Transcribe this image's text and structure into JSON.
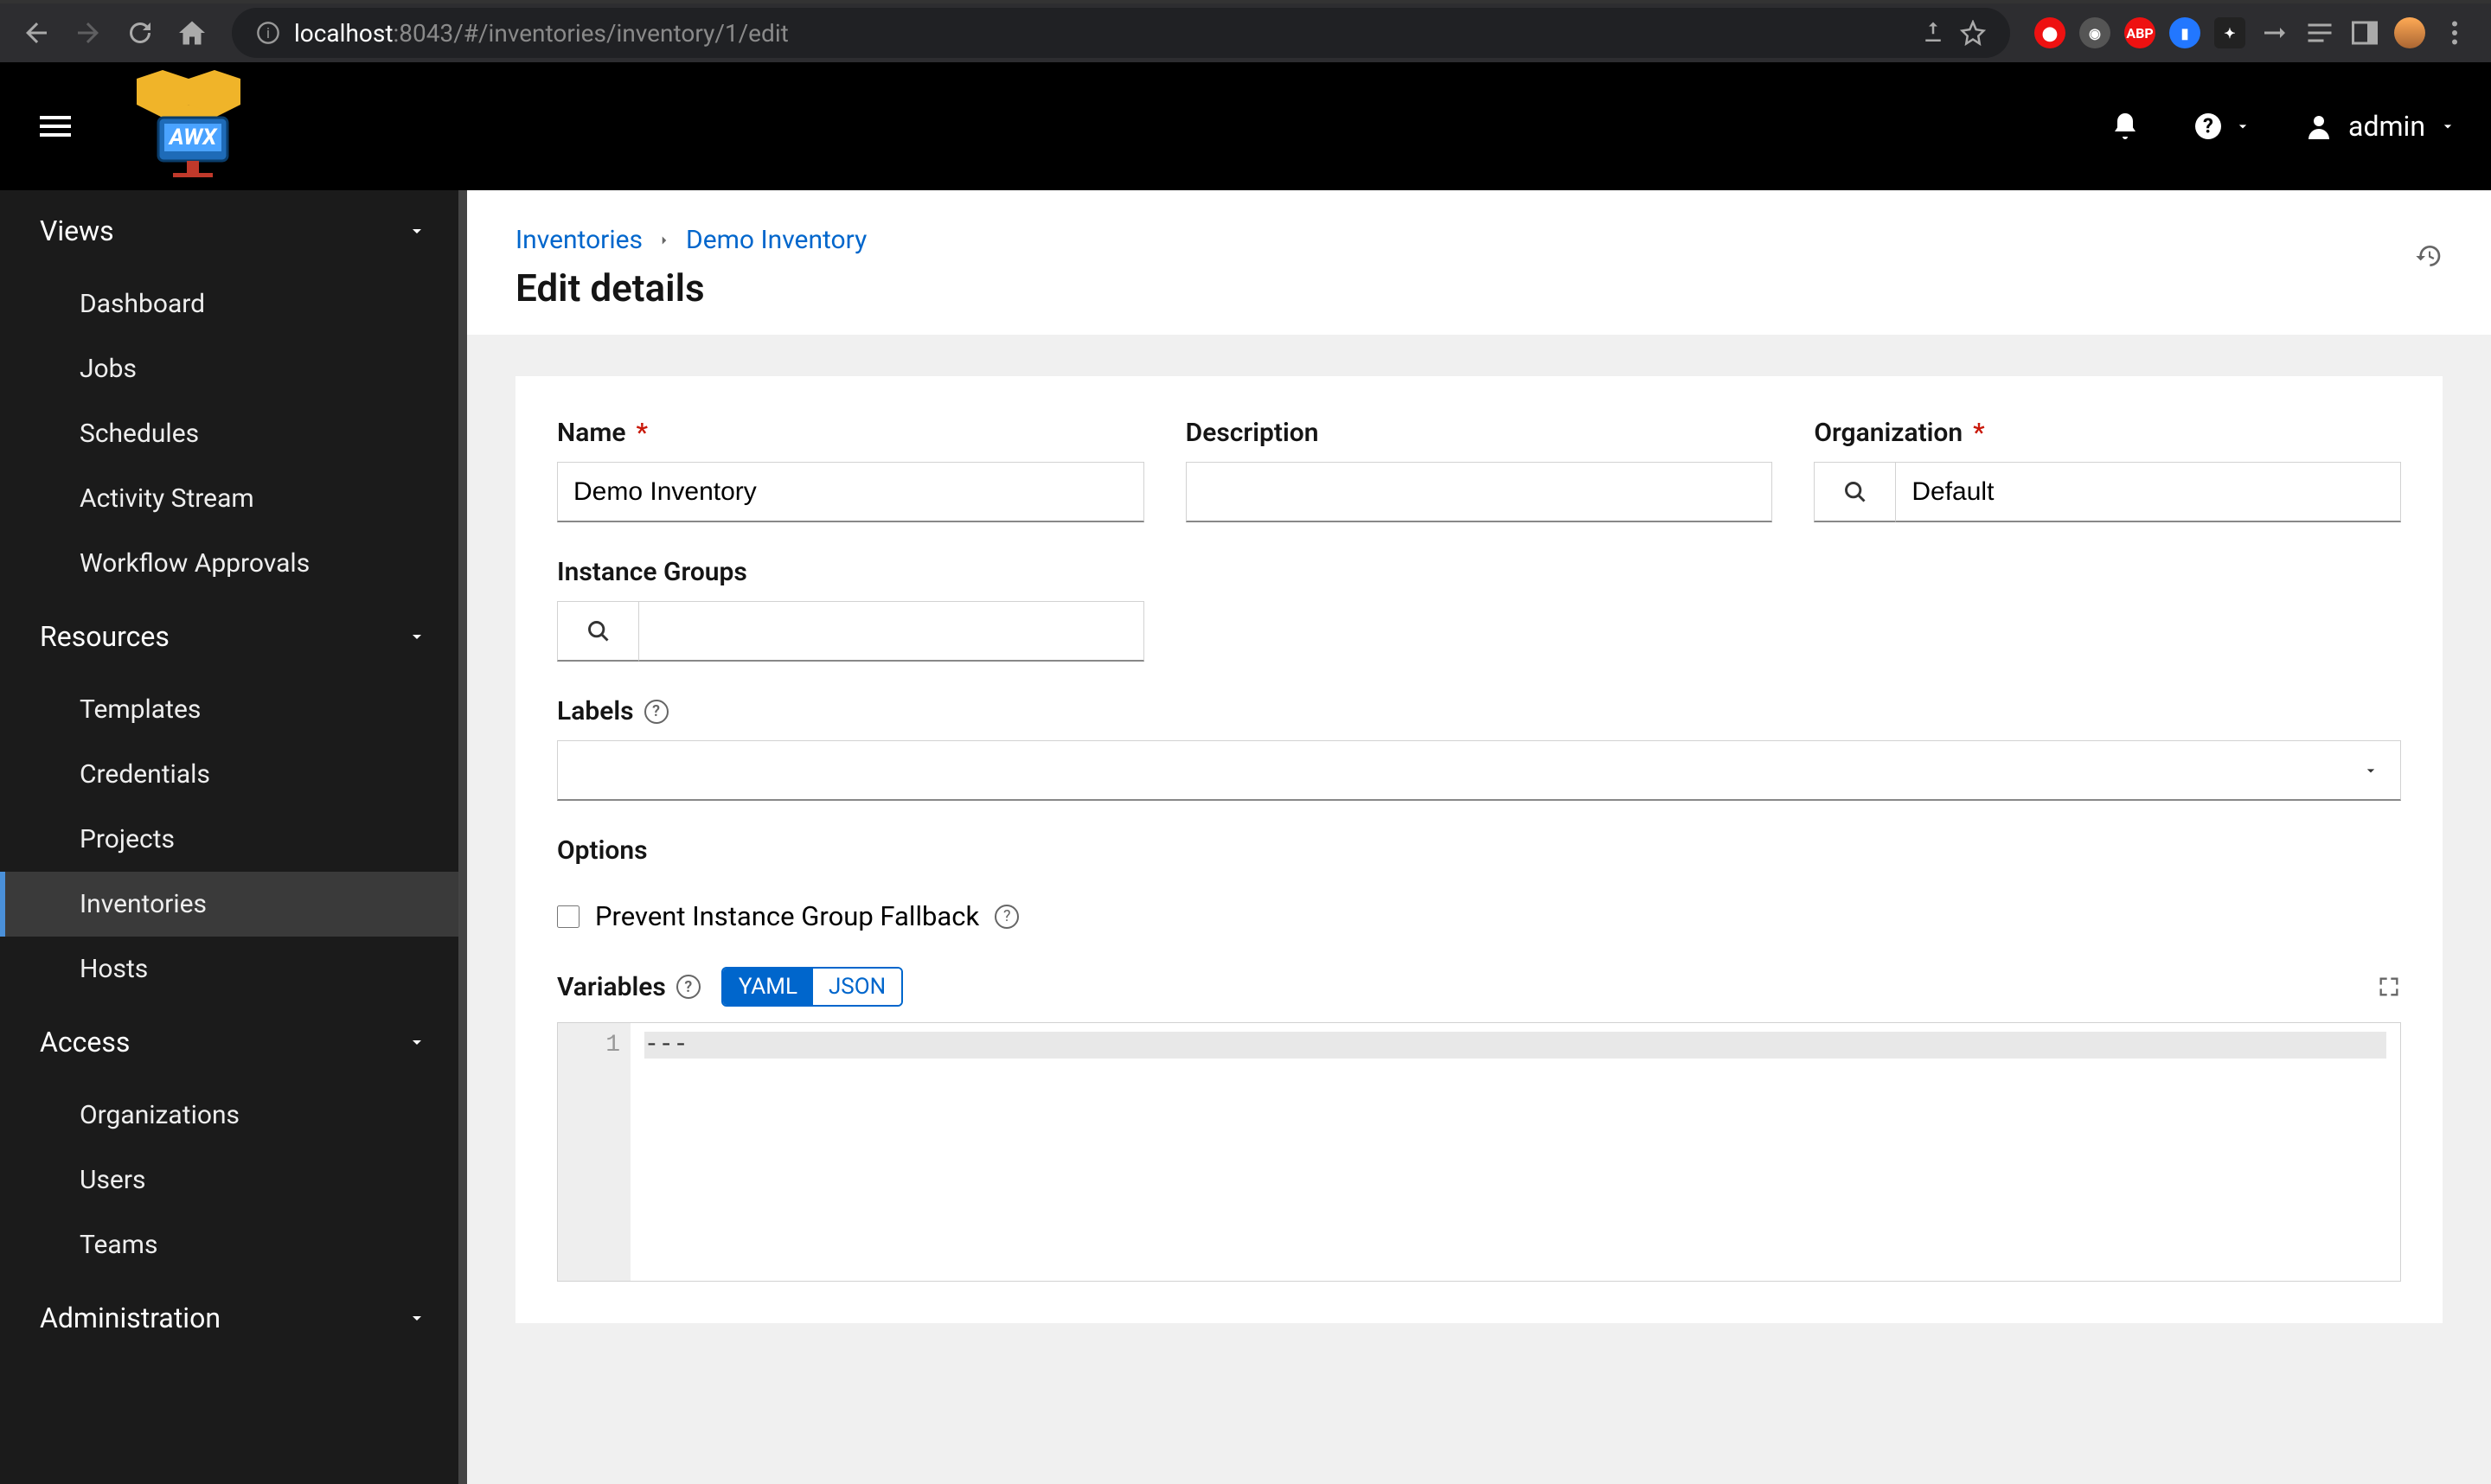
{
  "browser": {
    "url_host": "localhost",
    "url_path": ":8043/#/inventories/inventory/1/edit"
  },
  "header": {
    "username": "admin"
  },
  "sidebar": {
    "sections": [
      {
        "label": "Views",
        "items": [
          "Dashboard",
          "Jobs",
          "Schedules",
          "Activity Stream",
          "Workflow Approvals"
        ]
      },
      {
        "label": "Resources",
        "items": [
          "Templates",
          "Credentials",
          "Projects",
          "Inventories",
          "Hosts"
        ],
        "active_index": 3
      },
      {
        "label": "Access",
        "items": [
          "Organizations",
          "Users",
          "Teams"
        ]
      },
      {
        "label": "Administration",
        "items": []
      }
    ]
  },
  "breadcrumb": {
    "root": "Inventories",
    "item": "Demo Inventory"
  },
  "page": {
    "title": "Edit details"
  },
  "form": {
    "name_label": "Name",
    "name_value": "Demo Inventory",
    "description_label": "Description",
    "description_value": "",
    "organization_label": "Organization",
    "organization_value": "Default",
    "instance_groups_label": "Instance Groups",
    "instance_groups_value": "",
    "labels_label": "Labels",
    "options_label": "Options",
    "prevent_fallback_label": "Prevent Instance Group Fallback",
    "prevent_fallback_checked": false,
    "variables_label": "Variables",
    "variables_mode_yaml": "YAML",
    "variables_mode_json": "JSON",
    "variables_content": "---",
    "variables_line_number": "1"
  }
}
